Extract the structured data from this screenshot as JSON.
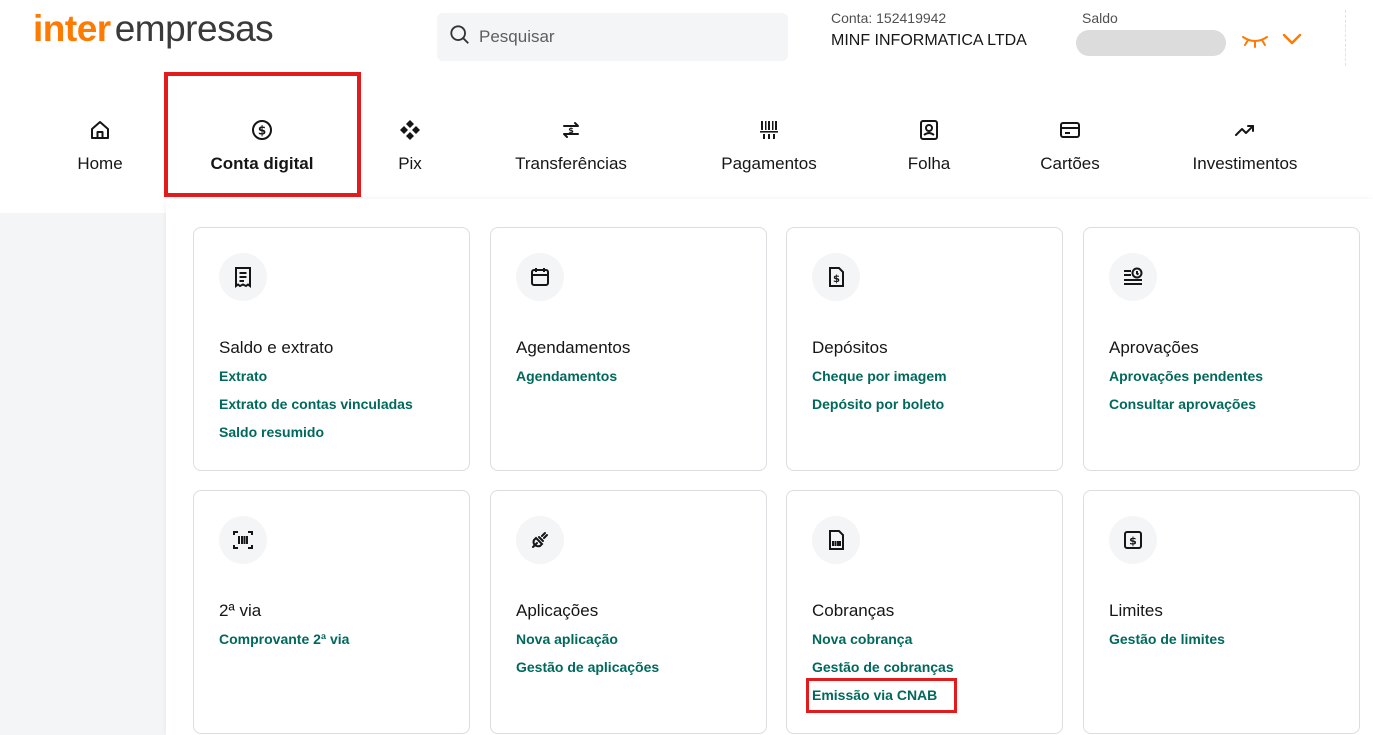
{
  "brand": {
    "part1": "inter",
    "part2": "empresas"
  },
  "search": {
    "placeholder": "Pesquisar"
  },
  "account": {
    "label": "Conta: 152419942",
    "name": "MINF INFORMATICA LTDA"
  },
  "balance": {
    "label": "Saldo"
  },
  "nav": {
    "items": [
      {
        "label": "Home",
        "icon": "home-icon"
      },
      {
        "label": "Conta digital",
        "icon": "dollar-circle-icon",
        "active": true
      },
      {
        "label": "Pix",
        "icon": "pix-icon"
      },
      {
        "label": "Transferências",
        "icon": "transfer-icon"
      },
      {
        "label": "Pagamentos",
        "icon": "barcode-icon"
      },
      {
        "label": "Folha",
        "icon": "badge-icon"
      },
      {
        "label": "Cartões",
        "icon": "card-icon"
      },
      {
        "label": "Investimentos",
        "icon": "trend-up-icon"
      }
    ]
  },
  "cards": [
    {
      "title": "Saldo e extrato",
      "icon": "receipt-icon",
      "links": [
        "Extrato",
        "Extrato de contas vinculadas",
        "Saldo resumido"
      ]
    },
    {
      "title": "Agendamentos",
      "icon": "calendar-icon",
      "links": [
        "Agendamentos"
      ]
    },
    {
      "title": "Depósitos",
      "icon": "cheque-icon",
      "links": [
        "Cheque por imagem",
        "Depósito por boleto"
      ]
    },
    {
      "title": "Aprovações",
      "icon": "approval-clock-icon",
      "links": [
        "Aprovações pendentes",
        "Consultar aprovações"
      ]
    },
    {
      "title": "2ª via",
      "icon": "scan-barcode-icon",
      "links": [
        "Comprovante 2ª via"
      ]
    },
    {
      "title": "Aplicações",
      "icon": "plug-icon",
      "links": [
        "Nova aplicação",
        "Gestão de aplicações"
      ]
    },
    {
      "title": "Cobranças",
      "icon": "boleto-doc-icon",
      "links": [
        "Nova cobrança",
        "Gestão de cobranças",
        "Emissão via CNAB"
      ]
    },
    {
      "title": "Limites",
      "icon": "limit-dollar-icon",
      "links": [
        "Gestão de limites"
      ]
    }
  ],
  "colors": {
    "brand": "#ff7a00",
    "link": "#00695c",
    "highlight": "#e21c1c"
  }
}
